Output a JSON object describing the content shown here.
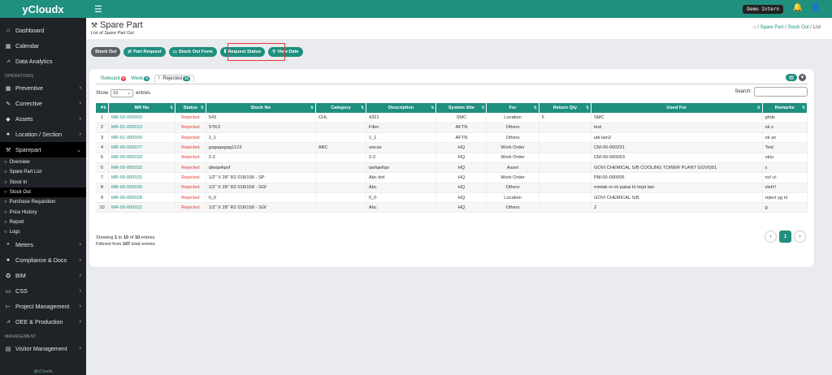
{
  "app": {
    "brand": "yCloudx",
    "demo_user": "Demo Intern",
    "footer": "@yCloudx"
  },
  "sidebar": {
    "top_items": [
      {
        "label": "Dashboard",
        "icon": "home-icon"
      },
      {
        "label": "Calendar",
        "icon": "calendar-icon"
      },
      {
        "label": "Data Analytics",
        "icon": "chart-icon"
      }
    ],
    "section_operations": "OPERATIONS",
    "ops_items": [
      {
        "label": "Preventive",
        "icon": "calendar-icon"
      },
      {
        "label": "Corrective",
        "icon": "wrench-icon"
      },
      {
        "label": "Assets",
        "icon": "tag-icon"
      },
      {
        "label": "Location / Section",
        "icon": "location-icon"
      },
      {
        "label": "Sparepart",
        "icon": "tools-icon"
      }
    ],
    "sparepart_sub": [
      "Overview",
      "Spare Part List",
      "Stock In",
      "Stock Out",
      "Purchase Requisition",
      "Price History",
      "Report",
      "Logs"
    ],
    "lower_items": [
      {
        "label": "Meters",
        "icon": "gauge-icon"
      },
      {
        "label": "Compliance & Docs",
        "icon": "circle-icon"
      },
      {
        "label": "BIM",
        "icon": "bim-icon"
      },
      {
        "label": "CSS",
        "icon": "monitor-icon"
      },
      {
        "label": "Project Management",
        "icon": "project-icon"
      },
      {
        "label": "OEE & Production",
        "icon": "chart-icon"
      }
    ],
    "section_management": "MANAGEMENT",
    "mgmt_items": [
      {
        "label": "Visitor Management",
        "icon": "visitor-icon"
      }
    ]
  },
  "page": {
    "title": "Spare Part",
    "subtitle": "List of Spare Part Out",
    "breadcrumb": [
      "Spare Part",
      "Stock Out",
      "List"
    ]
  },
  "buttons": [
    "Stock Out",
    "Part Request",
    "Stock Out Form",
    "Request Status",
    "View Date"
  ],
  "tabs": [
    {
      "label": "Relevant",
      "count": "0"
    },
    {
      "label": "Week",
      "count": "0"
    },
    {
      "label": "Rejected",
      "count": "10"
    }
  ],
  "show": {
    "prefix": "Show",
    "value": "10",
    "suffix": "entries"
  },
  "search": {
    "label": "Search:"
  },
  "table": {
    "headers": [
      "#",
      "MR No",
      "Status",
      "Stock No",
      "Category",
      "Description",
      "System Site",
      "For",
      "Return Qty",
      "Used For",
      "Remarks"
    ],
    "rows": [
      [
        "1",
        "MR-02-000003",
        "Rejected",
        "543",
        "CHL",
        "4321",
        "SMC",
        "Location",
        "5",
        "SMC",
        "ghds"
      ],
      [
        "2",
        "MR-01-000010",
        "Rejected",
        "STK3",
        "",
        "Filter",
        "AFTN",
        "Others",
        "",
        "test",
        "ok x"
      ],
      [
        "3",
        "MR-01-000009",
        "Rejected",
        "1_1",
        "",
        "1_1",
        "AFTN",
        "Others",
        "",
        "utk lain2",
        "ok ye"
      ],
      [
        "4",
        "MR-00-000077",
        "Rejected",
        "gagagagag1123",
        "ABC",
        "swcas",
        "HQ",
        "Work Order",
        "",
        "CM-00-000231",
        "Test"
      ],
      [
        "5",
        "MR-00-000033",
        "Rejected",
        "2-2",
        "",
        "2-2",
        "HQ",
        "Work Order",
        "",
        "CM-00-000053",
        "okiu"
      ],
      [
        "6",
        "MR-00-000032",
        "Rejected",
        "qfwqwfqwf",
        "",
        "qwfqwfqw",
        "HQ",
        "Asset",
        "",
        "GOVI CHEMICAL S/B COOLING TOWER PLANT GOVI001",
        "s"
      ],
      [
        "7",
        "MR-00-000031",
        "Rejected",
        "1/2\" X 28\" R2 018/158 - SP",
        "",
        "Abc def",
        "HQ",
        "Work Order",
        "",
        "PM-00-000005",
        "no! u!"
      ],
      [
        "8",
        "MR-00-000030",
        "Rejected",
        "1/2\" X 28\" R2 018/158 - SGf",
        "",
        "Abc",
        "HQ",
        "Others",
        "",
        "mintak ni nk pakai kt tmpt lain",
        "xleh!!"
      ],
      [
        "9",
        "MR-00-000028",
        "Rejected",
        "0_0",
        "",
        "0_0",
        "HQ",
        "Location",
        "",
        "GOVI CHEMICAL S/B",
        "reject yg ni"
      ],
      [
        "10",
        "MR-00-000021",
        "Rejected",
        "1/2\" X 28\" R2 018/158 - SGf",
        "",
        "Abc",
        "HQ",
        "Others",
        "",
        "2",
        "g"
      ]
    ]
  },
  "info": {
    "line1_a": "Showing ",
    "line1_b": "1",
    "line1_c": " to ",
    "line1_d": "10",
    "line1_e": " of ",
    "line1_f": "10",
    "line1_g": " entries",
    "line2_a": "Filtered from ",
    "line2_b": "107",
    "line2_c": " total entries"
  },
  "pager": {
    "current": "1",
    "prev": "‹",
    "next": "›"
  },
  "colors": {
    "accent": "#1f8f7e",
    "reject": "#e53935",
    "sidebar": "#1f2327"
  }
}
